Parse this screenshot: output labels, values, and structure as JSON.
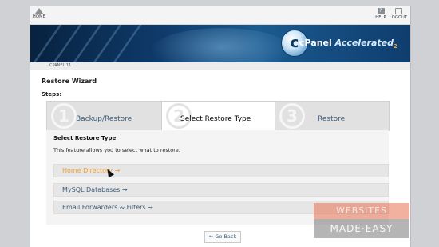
{
  "nav": {
    "home": "HOME",
    "help": "HELP",
    "logout": "LOGOUT",
    "help_glyph": "?"
  },
  "banner": {
    "logo_letter": "c",
    "brand": "cPanel",
    "brand_accent": "Accelerated",
    "brand_sub": "2"
  },
  "subbar": {
    "label": "CPANEL 11"
  },
  "page": {
    "title": "Restore Wizard",
    "steps_label": "Steps:"
  },
  "steps": [
    {
      "num": "1",
      "label": "Backup/Restore"
    },
    {
      "num": "2",
      "label": "Select Restore Type"
    },
    {
      "num": "3",
      "label": "Restore"
    }
  ],
  "panel": {
    "title": "Select Restore Type",
    "description": "This feature allows you to select what to restore.",
    "options": [
      {
        "label": "Home Directory →"
      },
      {
        "label": "MySQL Databases →"
      },
      {
        "label": "Email Forwarders & Filters →"
      }
    ]
  },
  "go_back": "← Go Back",
  "watermark": {
    "top": "WEBSITES",
    "bottom": "MADE·EASY"
  },
  "colors": {
    "link": "#3b5c77",
    "hover": "#f0a030",
    "banner": "#0f3b6b"
  }
}
